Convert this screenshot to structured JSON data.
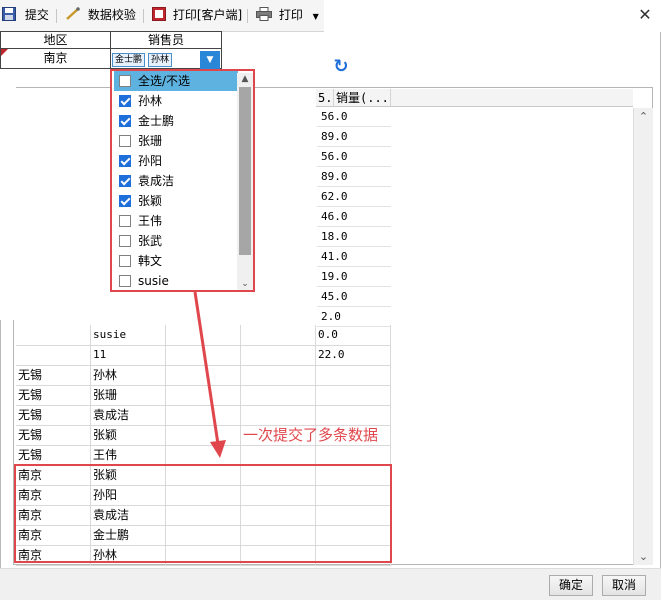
{
  "toolbar": {
    "submit_label": "提交",
    "validate_label": "数据校验",
    "print_client_label": "打印[客户端]",
    "print_label": "打印"
  },
  "filter": {
    "region_header": "地区",
    "salesperson_header": "销售员",
    "region_value": "南京",
    "selected_tags": [
      "金士鹏",
      "孙林"
    ]
  },
  "dropdown": {
    "select_all_label": "全选/不选",
    "items": [
      {
        "label": "孙林",
        "checked": true
      },
      {
        "label": "金士鹏",
        "checked": true
      },
      {
        "label": "张珊",
        "checked": false
      },
      {
        "label": "孙阳",
        "checked": true
      },
      {
        "label": "袁成洁",
        "checked": true
      },
      {
        "label": "张颖",
        "checked": true
      },
      {
        "label": "王伟",
        "checked": false
      },
      {
        "label": "张武",
        "checked": false
      },
      {
        "label": "韩文",
        "checked": false
      },
      {
        "label": "susie",
        "checked": false
      }
    ]
  },
  "grid": {
    "header_fragment": "5.",
    "qty_header": "销量(...",
    "qty_values": [
      "56.0",
      "89.0",
      "56.0",
      "89.0",
      "62.0",
      "46.0",
      "18.0",
      "41.0",
      "19.0",
      "45.0",
      "2.0"
    ],
    "rows": [
      {
        "region": "",
        "salesperson": "susie",
        "qty": "0.0"
      },
      {
        "region": "",
        "salesperson": "11",
        "qty": "22.0"
      },
      {
        "region": "无锡",
        "salesperson": "孙林",
        "qty": ""
      },
      {
        "region": "无锡",
        "salesperson": "张珊",
        "qty": ""
      },
      {
        "region": "无锡",
        "salesperson": "袁成洁",
        "qty": ""
      },
      {
        "region": "无锡",
        "salesperson": "张颖",
        "qty": ""
      },
      {
        "region": "无锡",
        "salesperson": "王伟",
        "qty": ""
      },
      {
        "region": "南京",
        "salesperson": "张颖",
        "qty": ""
      },
      {
        "region": "南京",
        "salesperson": "孙阳",
        "qty": ""
      },
      {
        "region": "南京",
        "salesperson": "袁成洁",
        "qty": ""
      },
      {
        "region": "南京",
        "salesperson": "金士鹏",
        "qty": ""
      },
      {
        "region": "南京",
        "salesperson": "孙林",
        "qty": ""
      }
    ]
  },
  "annotation": {
    "text": "一次提交了多条数据"
  },
  "buttons": {
    "ok_label": "确定",
    "cancel_label": "取消"
  },
  "colors": {
    "annotation_red": "#e0474c",
    "accent_blue": "#1e6fd9"
  },
  "icons": [
    "save-icon",
    "validate-icon",
    "print-client-icon",
    "printer-icon",
    "refresh-icon",
    "close-icon"
  ]
}
